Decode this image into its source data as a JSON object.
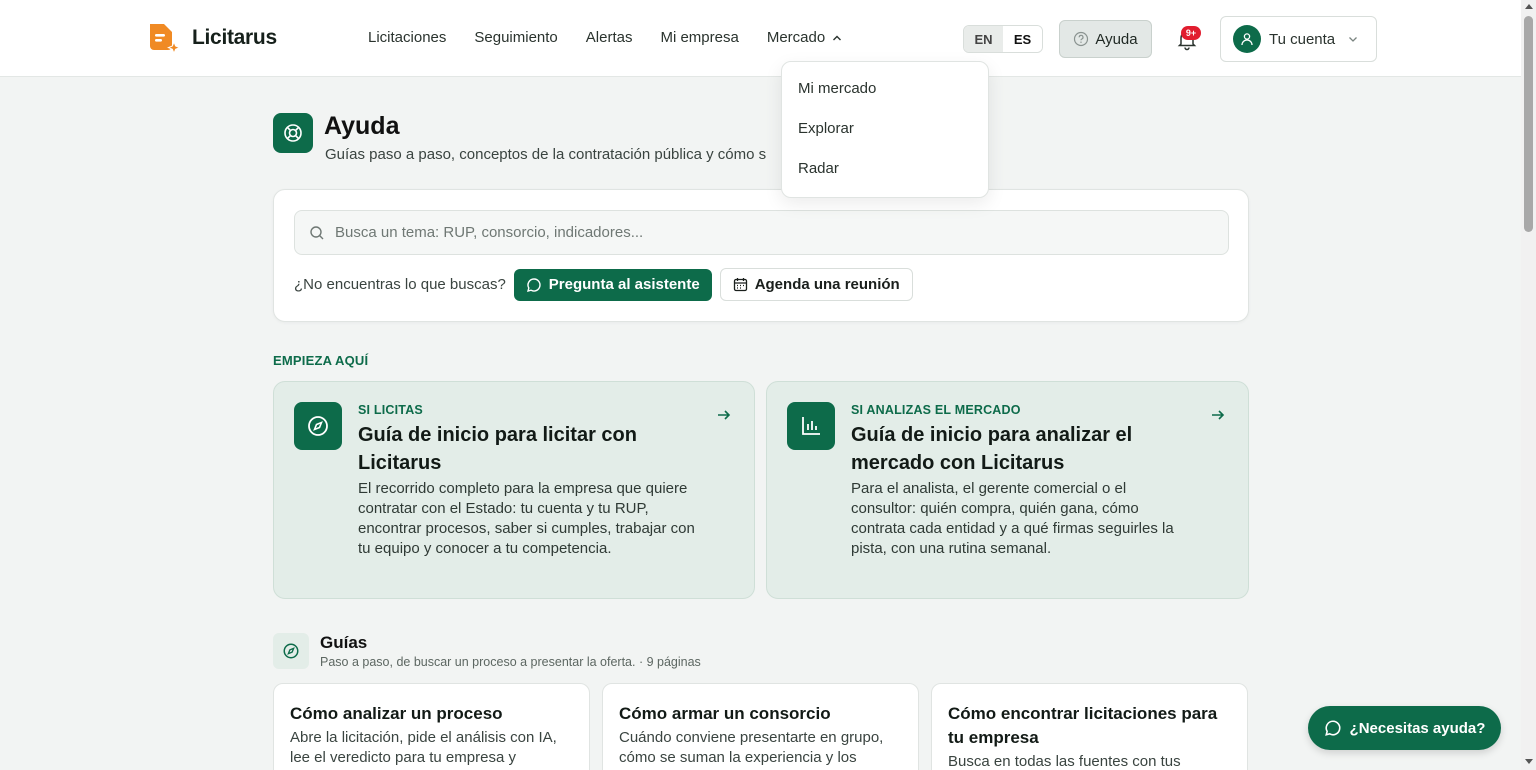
{
  "brand": {
    "name": "Licitarus",
    "accent": "#0d6b4a",
    "logo_color": "#f08a24"
  },
  "nav": {
    "items": [
      "Licitaciones",
      "Seguimiento",
      "Alertas",
      "Mi empresa"
    ],
    "market_label": "Mercado"
  },
  "market_menu": [
    "Mi mercado",
    "Explorar",
    "Radar"
  ],
  "lang": {
    "en": "EN",
    "es": "ES",
    "active": "ES"
  },
  "header": {
    "help_label": "Ayuda",
    "notifications_badge": "9+",
    "account_label": "Tu cuenta"
  },
  "page": {
    "title": "Ayuda",
    "subtitle": "Guías paso a paso, conceptos de la contratación pública y cómo s"
  },
  "search": {
    "placeholder": "Busca un tema: RUP, consorcio, indicadores...",
    "prompt": "¿No encuentras lo que buscas?",
    "assistant_label": "Pregunta al asistente",
    "meeting_label": "Agenda una reunión"
  },
  "start": {
    "label": "EMPIEZA AQUÍ",
    "cards": [
      {
        "eyebrow": "SI LICITAS",
        "title": "Guía de inicio para licitar con Licitarus",
        "description": "El recorrido completo para la empresa que quiere contratar con el Estado: tu cuenta y tu RUP, encontrar procesos, saber si cumples, trabajar con tu equipo y conocer a tu competencia.",
        "icon": "compass-icon"
      },
      {
        "eyebrow": "SI ANALIZAS EL MERCADO",
        "title": "Guía de inicio para analizar el mercado con Licitarus",
        "description": "Para el analista, el gerente comercial o el consultor: quién compra, quién gana, cómo contrata cada entidad y a qué firmas seguirles la pista, con una rutina semanal.",
        "icon": "bar-chart-icon"
      }
    ]
  },
  "guides": {
    "title": "Guías",
    "subtitle": "Paso a paso, de buscar un proceso a presentar la oferta. · 9 páginas",
    "cards": [
      {
        "title": "Cómo analizar un proceso",
        "description": "Abre la licitación, pide el análisis con IA, lee el veredicto para tu empresa y"
      },
      {
        "title": "Cómo armar un consorcio",
        "description": "Cuándo conviene presentarte en grupo, cómo se suman la experiencia y los"
      },
      {
        "title": "Cómo encontrar licitaciones para tu empresa",
        "description": "Busca en todas las fuentes con tus"
      }
    ]
  },
  "fab": {
    "label": "¿Necesitas ayuda?"
  }
}
